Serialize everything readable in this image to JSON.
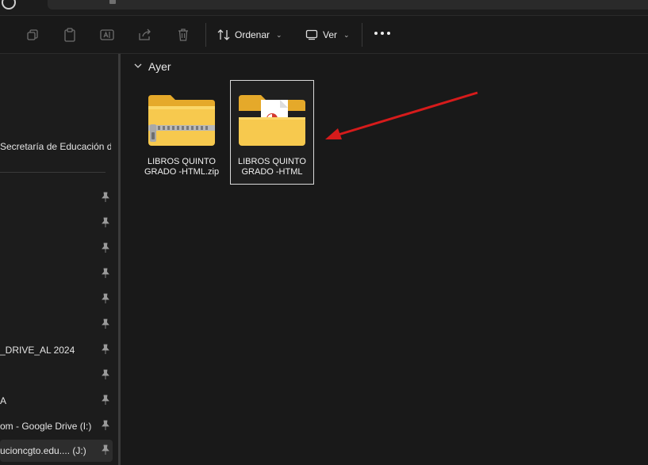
{
  "toolbar": {
    "sort_label": "Ordenar",
    "view_label": "Ver",
    "chevron": "⌄"
  },
  "sidebar": {
    "items": [
      {
        "label": "Secretaría de Educación de G",
        "pinned": false
      },
      {
        "label": "",
        "pinned": true
      },
      {
        "label": "",
        "pinned": true
      },
      {
        "label": "",
        "pinned": true
      },
      {
        "label": "",
        "pinned": true
      },
      {
        "label": "",
        "pinned": true
      },
      {
        "label": "",
        "pinned": true
      },
      {
        "label": "_DRIVE_AL 2024",
        "pinned": true
      },
      {
        "label": "",
        "pinned": true
      },
      {
        "label": "A",
        "pinned": true
      },
      {
        "label": "om - Google Drive (I:)",
        "pinned": true
      },
      {
        "label": "ucioncgto.edu.... (J:)",
        "pinned": true,
        "active": true
      }
    ]
  },
  "content": {
    "group_label": "Ayer",
    "files": [
      {
        "name": "LIBROS QUINTO GRADO -HTML.zip",
        "type": "zip-folder",
        "selected": false
      },
      {
        "name": "LIBROS QUINTO GRADO -HTML",
        "type": "folder",
        "selected": true
      }
    ]
  },
  "colors": {
    "background": "#191919",
    "folder": "#f5c542",
    "annotation_arrow": "#d61b1b"
  }
}
